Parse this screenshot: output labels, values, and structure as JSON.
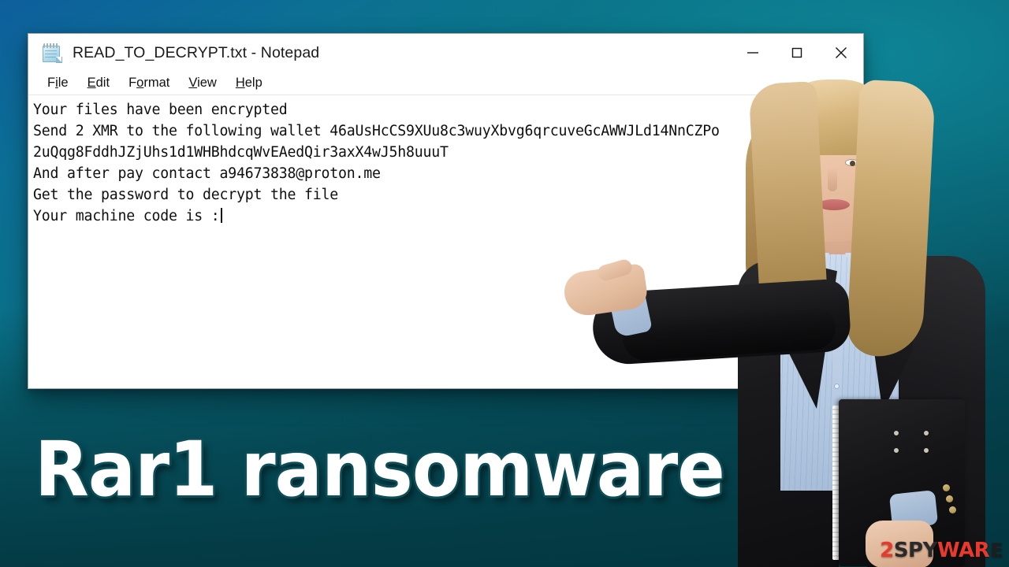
{
  "window": {
    "title": "READ_TO_DECRYPT.txt - Notepad",
    "icon": "notepad-icon",
    "controls": {
      "minimize": "minimize-button",
      "maximize": "maximize-button",
      "close": "close-button"
    },
    "menu": [
      {
        "label": "File",
        "pre": "F",
        "accel": "i",
        "post": "le"
      },
      {
        "label": "Edit",
        "pre": "",
        "accel": "E",
        "post": "dit"
      },
      {
        "label": "Format",
        "pre": "F",
        "accel": "o",
        "post": "rmat"
      },
      {
        "label": "View",
        "pre": "",
        "accel": "V",
        "post": "iew"
      },
      {
        "label": "Help",
        "pre": "",
        "accel": "H",
        "post": "elp"
      }
    ],
    "document": {
      "lines": [
        "Your files have been encrypted",
        "Send 2 XMR to the following wallet 46aUsHcCS9XUu8c3wuyXbvg6qrcuveGcAWWJLd14NnCZPo",
        "2uQqg8FddhJZjUhs1d1WHBhdcqWvEAedQir3axX4wJ5h8uuuT",
        "And after pay contact a94673838@proton.me",
        "Get the password to decrypt the file",
        "Your machine code is :"
      ],
      "ransom_details": {
        "amount": "2 XMR",
        "wallet": "46aUsHcCS9XUu8c3wuyXbvg6qrcuveGcAWWJLd14NnCZPo2uQqg8FddhJZjUhs1d1WHBhdcqWvEAedQir3axX4wJ5h8uuuT",
        "contact_email": "a94673838@proton.me"
      },
      "caret_after_line": 6
    },
    "scrollbar": {
      "up_arrow": "scroll-up-arrow"
    }
  },
  "caption": {
    "text": "Rar1 ransomware"
  },
  "watermark": {
    "part1": "2",
    "part2": "SPY",
    "part3": "WAR",
    "part4": "E"
  },
  "colors": {
    "background_top_left": "#115c93",
    "background_teal": "#0d8090",
    "background_bottom": "#043a44",
    "window_bg": "#ffffff",
    "text": "#0f0f0f",
    "caption_fill": "#ffffff",
    "caption_outline": "#0c4e58",
    "watermark_red": "#e8392c"
  }
}
